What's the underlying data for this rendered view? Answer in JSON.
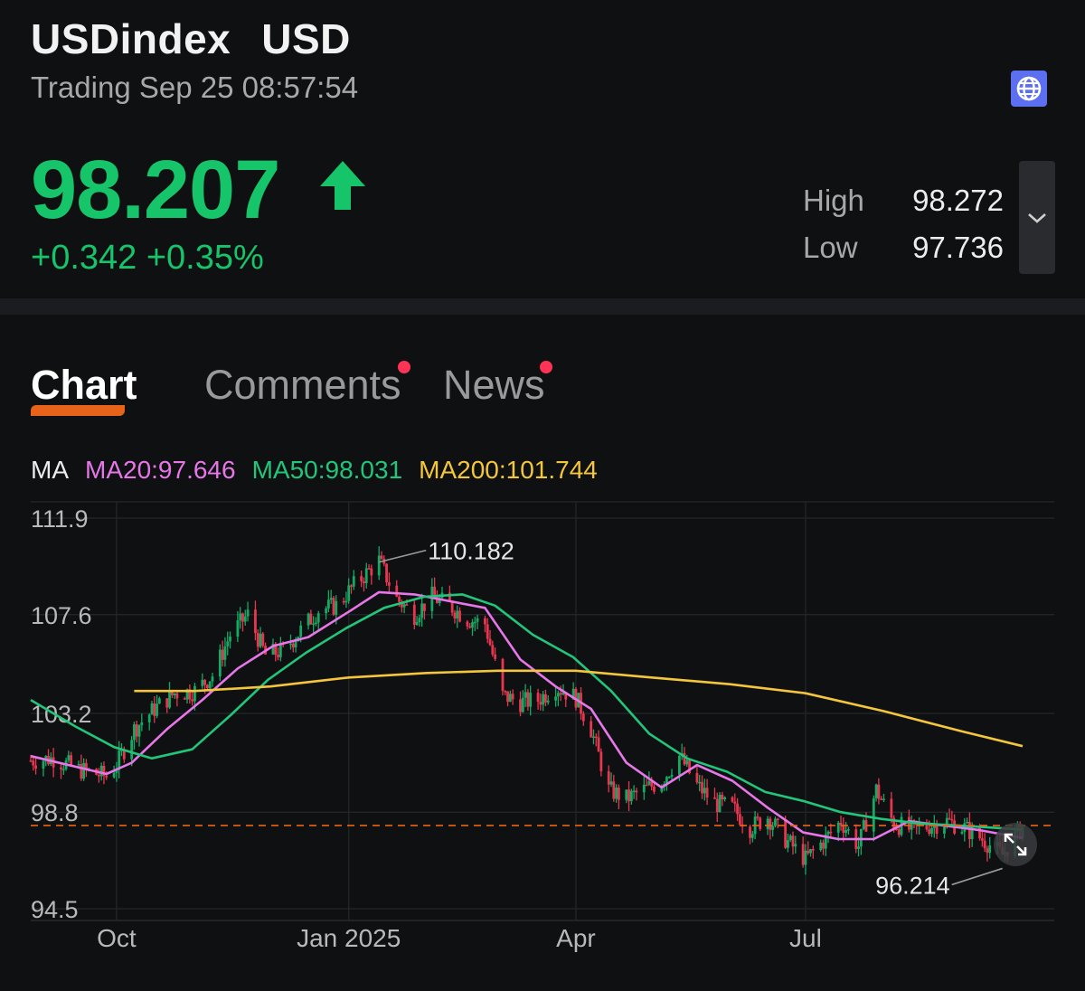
{
  "header": {
    "symbol": "USDindex",
    "currency": "USD",
    "status": "Trading Sep 25 08:57:54",
    "price": "98.207",
    "change": "+0.342",
    "change_pct": "+0.35%",
    "high_label": "High",
    "high_value": "98.272",
    "low_label": "Low",
    "low_value": "97.736",
    "colors": {
      "up": "#16c46a",
      "accent": "#e8631a",
      "globe_bg": "#5b6ff0"
    }
  },
  "tabs": [
    {
      "label": "Chart",
      "active": true,
      "badge": false
    },
    {
      "label": "Comments",
      "active": false,
      "badge": true
    },
    {
      "label": "News",
      "active": false,
      "badge": true
    }
  ],
  "ma_legend": {
    "prefix": "MA",
    "ma20": "MA20:97.646",
    "ma50": "MA50:98.031",
    "ma200": "MA200:101.744",
    "colors": {
      "ma20": "#e776e8",
      "ma50": "#22c57a",
      "ma200": "#f4c63b"
    }
  },
  "chart_data": {
    "type": "candlestick",
    "y_ticks": [
      "111.9",
      "107.6",
      "103.2",
      "98.8",
      "94.5"
    ],
    "y_tick_values": [
      111.9,
      107.6,
      103.2,
      98.8,
      94.5
    ],
    "ylim": [
      94.5,
      111.9
    ],
    "x_ticks": [
      "Oct",
      "Jan 2025",
      "Apr",
      "Jul"
    ],
    "x_tick_dates": [
      "2024-10-01",
      "2025-01-01",
      "2025-04-01",
      "2025-07-01"
    ],
    "xlim": [
      "2024-08-28",
      "2025-09-25"
    ],
    "current_price": 98.207,
    "annotations": [
      {
        "label": "110.182",
        "date": "2025-01-13",
        "value": 110.182
      },
      {
        "label": "96.214",
        "date": "2025-09-17",
        "value": 96.214
      }
    ],
    "close_series": [
      [
        "2024-08-28",
        101.1
      ],
      [
        "2024-09-06",
        101.2
      ],
      [
        "2024-09-16",
        100.7
      ],
      [
        "2024-09-27",
        100.4
      ],
      [
        "2024-10-01",
        100.9
      ],
      [
        "2024-10-08",
        102.5
      ],
      [
        "2024-10-16",
        103.4
      ],
      [
        "2024-10-24",
        104.1
      ],
      [
        "2024-11-01",
        104.2
      ],
      [
        "2024-11-08",
        104.9
      ],
      [
        "2024-11-15",
        106.7
      ],
      [
        "2024-11-22",
        107.6
      ],
      [
        "2024-11-29",
        105.8
      ],
      [
        "2024-12-06",
        106.0
      ],
      [
        "2024-12-13",
        106.9
      ],
      [
        "2024-12-20",
        107.8
      ],
      [
        "2024-12-27",
        108.0
      ],
      [
        "2025-01-03",
        108.9
      ],
      [
        "2025-01-13",
        110.0
      ],
      [
        "2025-01-20",
        108.3
      ],
      [
        "2025-01-27",
        107.6
      ],
      [
        "2025-02-03",
        108.4
      ],
      [
        "2025-02-10",
        108.0
      ],
      [
        "2025-02-17",
        107.4
      ],
      [
        "2025-02-24",
        107.2
      ],
      [
        "2025-03-03",
        104.0
      ],
      [
        "2025-03-10",
        103.7
      ],
      [
        "2025-03-17",
        103.8
      ],
      [
        "2025-03-24",
        104.4
      ],
      [
        "2025-04-01",
        103.9
      ],
      [
        "2025-04-07",
        102.5
      ],
      [
        "2025-04-14",
        99.8
      ],
      [
        "2025-04-21",
        99.4
      ],
      [
        "2025-04-28",
        99.8
      ],
      [
        "2025-05-05",
        100.2
      ],
      [
        "2025-05-12",
        101.3
      ],
      [
        "2025-05-19",
        100.0
      ],
      [
        "2025-05-26",
        99.2
      ],
      [
        "2025-06-02",
        99.0
      ],
      [
        "2025-06-09",
        98.1
      ],
      [
        "2025-06-16",
        98.6
      ],
      [
        "2025-06-23",
        97.6
      ],
      [
        "2025-07-01",
        96.7
      ],
      [
        "2025-07-08",
        97.5
      ],
      [
        "2025-07-15",
        98.4
      ],
      [
        "2025-07-22",
        97.3
      ],
      [
        "2025-07-29",
        99.8
      ],
      [
        "2025-08-05",
        98.3
      ],
      [
        "2025-08-12",
        98.0
      ],
      [
        "2025-08-19",
        98.2
      ],
      [
        "2025-08-26",
        98.4
      ],
      [
        "2025-09-02",
        98.1
      ],
      [
        "2025-09-09",
        97.6
      ],
      [
        "2025-09-17",
        96.9
      ],
      [
        "2025-09-25",
        98.2
      ]
    ],
    "series": [
      {
        "name": "MA20:97.646",
        "color": "#e776e8",
        "points": [
          [
            "2024-08-28",
            101.3
          ],
          [
            "2024-09-27",
            100.5
          ],
          [
            "2024-10-07",
            101.0
          ],
          [
            "2024-10-21",
            102.5
          ],
          [
            "2024-11-04",
            103.8
          ],
          [
            "2024-11-18",
            105.2
          ],
          [
            "2024-12-02",
            106.2
          ],
          [
            "2024-12-16",
            106.6
          ],
          [
            "2025-01-02",
            107.8
          ],
          [
            "2025-01-13",
            108.6
          ],
          [
            "2025-01-27",
            108.5
          ],
          [
            "2025-02-10",
            108.2
          ],
          [
            "2025-02-24",
            107.9
          ],
          [
            "2025-03-10",
            105.6
          ],
          [
            "2025-03-24",
            104.4
          ],
          [
            "2025-04-07",
            103.4
          ],
          [
            "2025-04-21",
            101.0
          ],
          [
            "2025-05-05",
            99.9
          ],
          [
            "2025-05-19",
            100.9
          ],
          [
            "2025-06-02",
            100.2
          ],
          [
            "2025-06-16",
            99.0
          ],
          [
            "2025-06-30",
            97.9
          ],
          [
            "2025-07-14",
            97.6
          ],
          [
            "2025-07-28",
            97.6
          ],
          [
            "2025-08-11",
            98.4
          ],
          [
            "2025-08-25",
            98.2
          ],
          [
            "2025-09-08",
            98.0
          ],
          [
            "2025-09-25",
            97.65
          ]
        ]
      },
      {
        "name": "MA50:98.031",
        "color": "#22c57a",
        "points": [
          [
            "2024-08-28",
            103.8
          ],
          [
            "2024-09-15",
            102.6
          ],
          [
            "2024-09-30",
            101.7
          ],
          [
            "2024-10-15",
            101.2
          ],
          [
            "2024-10-31",
            101.6
          ],
          [
            "2024-11-15",
            103.1
          ],
          [
            "2024-11-30",
            104.7
          ],
          [
            "2024-12-15",
            105.9
          ],
          [
            "2024-12-31",
            107.0
          ],
          [
            "2025-01-15",
            107.9
          ],
          [
            "2025-01-31",
            108.4
          ],
          [
            "2025-02-15",
            108.5
          ],
          [
            "2025-02-28",
            108.0
          ],
          [
            "2025-03-15",
            106.7
          ],
          [
            "2025-03-31",
            105.7
          ],
          [
            "2025-04-15",
            104.2
          ],
          [
            "2025-04-30",
            102.3
          ],
          [
            "2025-05-15",
            101.2
          ],
          [
            "2025-05-31",
            100.6
          ],
          [
            "2025-06-15",
            99.7
          ],
          [
            "2025-06-30",
            99.3
          ],
          [
            "2025-07-15",
            98.8
          ],
          [
            "2025-07-31",
            98.5
          ],
          [
            "2025-08-15",
            98.3
          ],
          [
            "2025-08-31",
            98.2
          ],
          [
            "2025-09-25",
            98.03
          ]
        ]
      },
      {
        "name": "MA200:101.744",
        "color": "#f4c63b",
        "points": [
          [
            "2024-10-08",
            104.2
          ],
          [
            "2024-11-01",
            104.2
          ],
          [
            "2024-12-01",
            104.4
          ],
          [
            "2025-01-01",
            104.8
          ],
          [
            "2025-02-01",
            105.0
          ],
          [
            "2025-03-01",
            105.1
          ],
          [
            "2025-04-01",
            105.1
          ],
          [
            "2025-05-01",
            104.8
          ],
          [
            "2025-06-01",
            104.5
          ],
          [
            "2025-07-01",
            104.1
          ],
          [
            "2025-08-01",
            103.3
          ],
          [
            "2025-09-01",
            102.4
          ],
          [
            "2025-09-25",
            101.74
          ]
        ]
      }
    ]
  }
}
